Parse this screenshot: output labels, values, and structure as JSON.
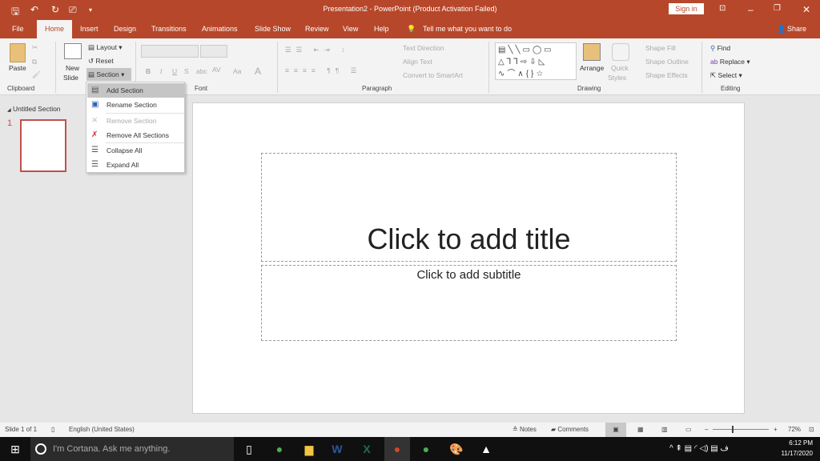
{
  "window": {
    "title": "Presentation2  -  PowerPoint (Product Activation Failed)",
    "sign_in": "Sign in"
  },
  "tabs": [
    "File",
    "Home",
    "Insert",
    "Design",
    "Transitions",
    "Animations",
    "Slide Show",
    "Review",
    "View",
    "Help"
  ],
  "tell_me": "Tell me what you want to do",
  "share": "Share",
  "ribbon": {
    "clipboard": {
      "paste": "Paste",
      "label": "Clipboard"
    },
    "slides": {
      "new_slide": "New",
      "new_slide2": "Slide",
      "layout": "Layout",
      "reset": "Reset",
      "section": "Section"
    },
    "font": {
      "label": "Font",
      "bold": "B",
      "italic": "I",
      "underline": "U",
      "strike": "S",
      "abc": "abc",
      "av": "AV",
      "aa": "Aa",
      "a": "A"
    },
    "paragraph": {
      "label": "Paragraph",
      "text_direction": "Text Direction",
      "align_text": "Align Text",
      "convert": "Convert to SmartArt"
    },
    "drawing": {
      "label": "Drawing",
      "arrange": "Arrange",
      "quick": "Quick",
      "styles": "Styles",
      "shape_fill": "Shape Fill",
      "shape_outline": "Shape Outline",
      "shape_effects": "Shape Effects"
    },
    "editing": {
      "label": "Editing",
      "find": "Find",
      "replace": "Replace",
      "select": "Select"
    }
  },
  "section_menu": [
    {
      "label": "Add Section",
      "enabled": true,
      "icon": "add-section"
    },
    {
      "label": "Rename Section",
      "enabled": true,
      "icon": "rename-section"
    },
    {
      "label": "Remove Section",
      "enabled": false,
      "icon": "remove-section"
    },
    {
      "label": "Remove All Sections",
      "enabled": true,
      "icon": "remove-all-sections"
    },
    {
      "label": "Collapse All",
      "enabled": true,
      "icon": "collapse-all"
    },
    {
      "label": "Expand All",
      "enabled": true,
      "icon": "expand-all"
    }
  ],
  "left_pane": {
    "section_name": "Untitled Section",
    "slide_number": "1"
  },
  "slide": {
    "title_placeholder": "Click to add title",
    "subtitle_placeholder": "Click to add subtitle"
  },
  "status": {
    "slide": "Slide 1 of 1",
    "language": "English (United States)",
    "notes": "Notes",
    "comments": "Comments",
    "zoom": "72%"
  },
  "taskbar": {
    "cortana": "I'm Cortana. Ask me anything.",
    "time": "6:12 PM",
    "date": "11/17/2020"
  },
  "colors": {
    "accent": "#b7472a"
  }
}
